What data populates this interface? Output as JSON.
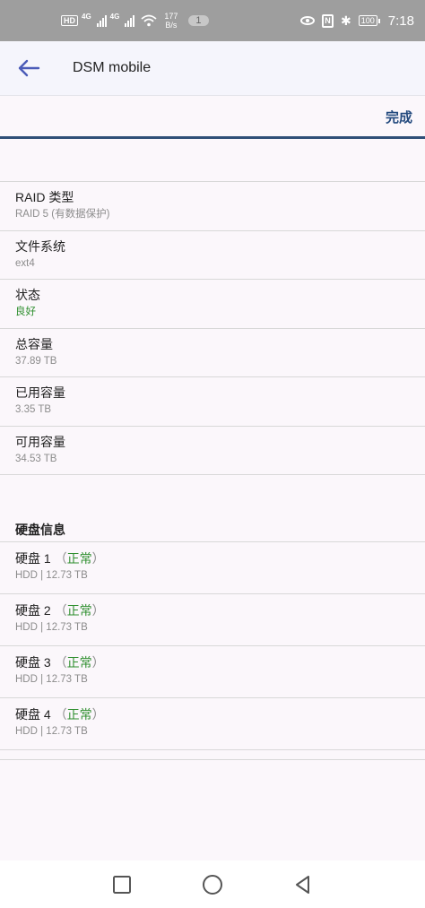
{
  "status_bar": {
    "hd_label": "HD",
    "net1": "4G",
    "net2": "4G",
    "speed_value": "177",
    "speed_unit": "B/s",
    "notification_count": "1",
    "nfc_label": "N",
    "battery": "100",
    "time": "7:18"
  },
  "app_bar": {
    "title": "DSM mobile",
    "back_icon": "arrow-left-icon"
  },
  "toolbar": {
    "done_label": "完成",
    "accent": "#2f4f78"
  },
  "volume_info": [
    {
      "title": "RAID 类型",
      "value": "RAID 5 (有数据保护)",
      "status": "normal"
    },
    {
      "title": "文件系统",
      "value": "ext4",
      "status": "normal"
    },
    {
      "title": "状态",
      "value": "良好",
      "status": "good"
    },
    {
      "title": "总容量",
      "value": "37.89 TB",
      "status": "normal"
    },
    {
      "title": "已用容量",
      "value": "3.35 TB",
      "status": "normal"
    },
    {
      "title": "可用容量",
      "value": "34.53 TB",
      "status": "normal"
    }
  ],
  "disks_section": {
    "title": "硬盘信息",
    "disks": [
      {
        "name": "硬盘 1",
        "open": "（",
        "status": "正常",
        "close": "）",
        "detail": "HDD | 12.73 TB"
      },
      {
        "name": "硬盘 2",
        "open": "（",
        "status": "正常",
        "close": "）",
        "detail": "HDD | 12.73 TB"
      },
      {
        "name": "硬盘 3",
        "open": "（",
        "status": "正常",
        "close": "）",
        "detail": "HDD | 12.73 TB"
      },
      {
        "name": "硬盘 4",
        "open": "（",
        "status": "正常",
        "close": "）",
        "detail": "HDD | 12.73 TB"
      }
    ]
  },
  "colors": {
    "good": "#2f8f2f",
    "muted": "#8c8c8c"
  },
  "nav_bar": {
    "icons": [
      "square-icon",
      "circle-icon",
      "triangle-back-icon"
    ]
  }
}
